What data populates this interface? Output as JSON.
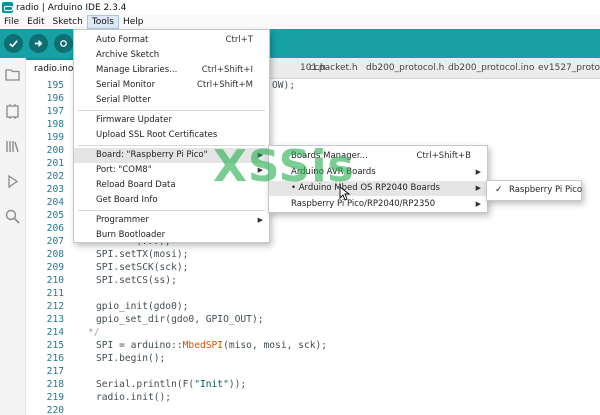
{
  "window": {
    "title": "radio | Arduino IDE 2.3.4"
  },
  "menubar": [
    "File",
    "Edit",
    "Sketch",
    "Tools",
    "Help"
  ],
  "toolbar": {
    "accent": "#17a1a5"
  },
  "tabs": [
    "radio.ino",
    "101.h",
    "ccpacket.h",
    "db200_protocol.h",
    "db200_protocol.ino",
    "ev1527_protoc"
  ],
  "editor": {
    "line_numbers": [
      "195",
      "196",
      "197",
      "198",
      "199",
      "200",
      "201",
      "202",
      "203",
      "204",
      "205",
      "206",
      "207",
      "208",
      "209",
      "210",
      "211",
      "212",
      "213",
      "214",
      "215",
      "216",
      "217",
      "218",
      "219",
      "220"
    ],
    "lines": {
      "l195": "OW);",
      "l207": "(...);",
      "l208": "SPI.setTX(mosi);",
      "l209": "SPI.setSCK(sck);",
      "l210": "SPI.setCS(ss);",
      "l212": "gpio_init(gdo0);",
      "l213": "gpio_set_dir(gdo0, GPIO_OUT);",
      "l214": "*/",
      "l215a": "SPI = arduino::",
      "l215b": "MbedSPI",
      "l215c": "(miso, mosi, sck);",
      "l216": "SPI.begin();",
      "l218a": "Serial.println(F(",
      "l218b": "\"Init\"",
      "l218c": "));",
      "l219": "radio.init();"
    }
  },
  "tools_menu": {
    "items": [
      {
        "label": "Auto Format",
        "shortcut": "Ctrl+T"
      },
      {
        "label": "Archive Sketch",
        "shortcut": ""
      },
      {
        "label": "Manage Libraries...",
        "shortcut": "Ctrl+Shift+I"
      },
      {
        "label": "Serial Monitor",
        "shortcut": "Ctrl+Shift+M"
      },
      {
        "label": "Serial Plotter",
        "shortcut": ""
      },
      {
        "label": "Firmware Updater",
        "shortcut": ""
      },
      {
        "label": "Upload SSL Root Certificates",
        "shortcut": ""
      },
      {
        "label": "Board: \"Raspberry Pi Pico\"",
        "shortcut": ""
      },
      {
        "label": "Port: \"COM8\"",
        "shortcut": ""
      },
      {
        "label": "Reload Board Data",
        "shortcut": ""
      },
      {
        "label": "Get Board Info",
        "shortcut": ""
      },
      {
        "label": "Programmer",
        "shortcut": ""
      },
      {
        "label": "Burn Bootloader",
        "shortcut": ""
      }
    ]
  },
  "board_menu": {
    "items": [
      {
        "label": "Boards Manager...",
        "shortcut": "Ctrl+Shift+B"
      },
      {
        "label": "Arduino AVR Boards",
        "shortcut": ""
      },
      {
        "label": "• Arduino Mbed OS RP2040 Boards",
        "shortcut": ""
      },
      {
        "label": "Raspberry Pi Pico/RP2040/RP2350",
        "shortcut": ""
      }
    ]
  },
  "mbed_menu": {
    "items": [
      {
        "label": "Raspberry Pi Pico",
        "checked": "✓"
      }
    ]
  },
  "watermark": "XSSis"
}
